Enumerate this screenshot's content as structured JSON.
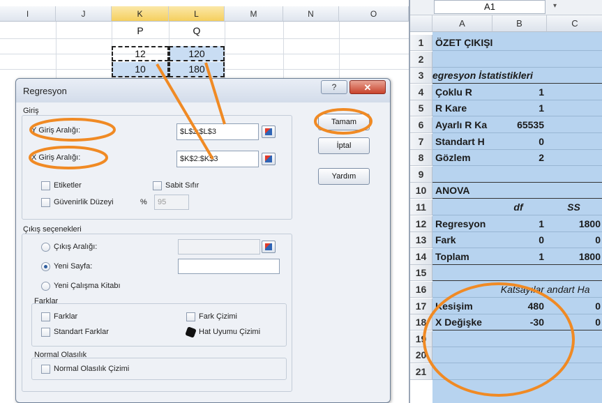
{
  "left_sheet": {
    "columns": [
      "I",
      "J",
      "K",
      "L",
      "M",
      "N",
      "O"
    ],
    "header_row": [
      "P",
      "Q"
    ],
    "row1": [
      "12",
      "120"
    ],
    "row2": [
      "10",
      "180"
    ]
  },
  "dialog": {
    "title": "Regresyon",
    "help_glyph": "?",
    "close_glyph": "✕",
    "input_group_label": "Giriş",
    "y_range_label": "Y Giriş Aralığı:",
    "y_range_value": "$L$2:$L$3",
    "x_range_label": "X Giriş Aralığı:",
    "x_range_value": "$K$2:$K$3",
    "labels_label": "Etiketler",
    "constant_zero_label": "Sabit Sıfır",
    "confidence_label": "Güvenirlik Düzeyi",
    "percent_sign": "%",
    "confidence_value": "95",
    "output_group_label": "Çıkış seçenekleri",
    "output_range_label": "Çıkış Aralığı:",
    "new_sheet_label": "Yeni Sayfa:",
    "new_workbook_label": "Yeni Çalışma Kitabı",
    "residuals_group_label": "Farklar",
    "residuals_label": "Farklar",
    "std_residuals_label": "Standart Farklar",
    "residual_plot_label": "Fark Çizimi",
    "line_fit_label": "Hat Uyumu Çizimi",
    "normal_group_label": "Normal Olasılık",
    "normal_plot_label": "Normal Olasılık Çizimi",
    "ok_label": "Tamam",
    "cancel_label": "İptal",
    "help_label": "Yardım"
  },
  "right_sheet": {
    "name_box": "A1",
    "columns": [
      "A",
      "B",
      "C"
    ],
    "rows": [
      {
        "n": "1",
        "a": "ÖZET ÇIKIŞI",
        "b": "",
        "c": ""
      },
      {
        "n": "2",
        "a": "",
        "b": "",
        "c": ""
      },
      {
        "n": "3",
        "a": "egresyon İstatistikleri",
        "b": "",
        "c": ""
      },
      {
        "n": "4",
        "a": "Çoklu R",
        "b": "1",
        "c": ""
      },
      {
        "n": "5",
        "a": "R Kare",
        "b": "1",
        "c": ""
      },
      {
        "n": "6",
        "a": "Ayarlı R Ka",
        "b": "65535",
        "c": ""
      },
      {
        "n": "7",
        "a": "Standart H",
        "b": "0",
        "c": ""
      },
      {
        "n": "8",
        "a": "Gözlem",
        "b": "2",
        "c": ""
      },
      {
        "n": "9",
        "a": "",
        "b": "",
        "c": ""
      },
      {
        "n": "10",
        "a": "ANOVA",
        "b": "",
        "c": ""
      },
      {
        "n": "11",
        "a": "",
        "b": "df",
        "c": "SS"
      },
      {
        "n": "12",
        "a": "Regresyon",
        "b": "1",
        "c": "1800"
      },
      {
        "n": "13",
        "a": "Fark",
        "b": "0",
        "c": "0"
      },
      {
        "n": "14",
        "a": "Toplam",
        "b": "1",
        "c": "1800"
      },
      {
        "n": "15",
        "a": "",
        "b": "",
        "c": ""
      },
      {
        "n": "16",
        "a": "",
        "b": "Katsayılar",
        "c": "andart Ha"
      },
      {
        "n": "17",
        "a": "Kesişim",
        "b": "480",
        "c": "0"
      },
      {
        "n": "18",
        "a": "X Değişke",
        "b": "-30",
        "c": "0"
      },
      {
        "n": "19",
        "a": "",
        "b": "",
        "c": ""
      },
      {
        "n": "20",
        "a": "",
        "b": "",
        "c": ""
      },
      {
        "n": "21",
        "a": "",
        "b": "",
        "c": ""
      }
    ]
  },
  "colors": {
    "annotation": "#f08a24",
    "selection": "#b7d3ef",
    "dialog_bg": "#eef1f6"
  }
}
